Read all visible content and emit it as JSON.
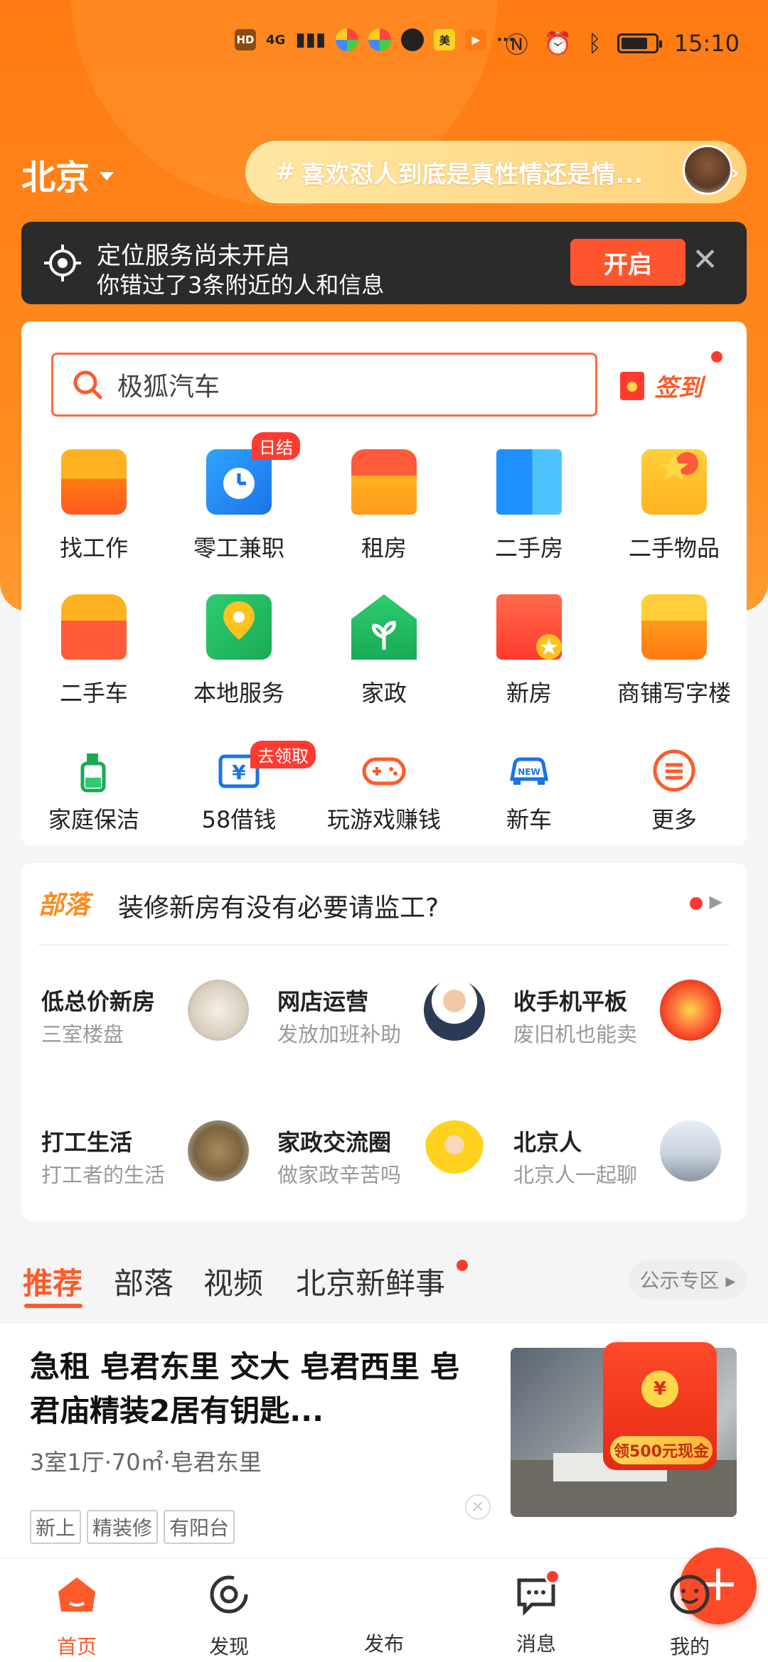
{
  "status_bar": {
    "left_badges": [
      "HD",
      "4G"
    ],
    "meituan_label": "美",
    "more": "···",
    "time": "15:10"
  },
  "header": {
    "city": "北京",
    "topic_hash": "#",
    "topic_text": "喜欢怼人到底是真性情还是情...",
    "chevron": "›"
  },
  "location_banner": {
    "title": "定位服务尚未开启",
    "subtitle": "你错过了3条附近的人和信息",
    "button": "开启",
    "close": "✕"
  },
  "search": {
    "placeholder": "极狐汽车",
    "signin_label": "签到"
  },
  "categories": [
    {
      "label": "找工作",
      "icon": "briefcase-icon"
    },
    {
      "label": "零工兼职",
      "icon": "clock-icon",
      "badge": "日结"
    },
    {
      "label": "租房",
      "icon": "sofa-icon"
    },
    {
      "label": "二手房",
      "icon": "building-icon"
    },
    {
      "label": "二手物品",
      "icon": "box-icon"
    },
    {
      "label": "二手车",
      "icon": "car-icon"
    },
    {
      "label": "本地服务",
      "icon": "map-pin-icon"
    },
    {
      "label": "家政",
      "icon": "house-leaf-icon"
    },
    {
      "label": "新房",
      "icon": "new-house-icon"
    },
    {
      "label": "商铺写字楼",
      "icon": "shop-icon"
    },
    {
      "label": "家庭保洁",
      "icon": "spray-bottle-icon"
    },
    {
      "label": "58借钱",
      "icon": "yuan-card-icon",
      "badge": "去领取"
    },
    {
      "label": "玩游戏赚钱",
      "icon": "gamepad-icon"
    },
    {
      "label": "新车",
      "icon": "new-car-icon"
    },
    {
      "label": "更多",
      "icon": "more-menu-icon"
    }
  ],
  "tribe": {
    "logo": "部落",
    "question": "装修新房有没有必要请监工?",
    "items": [
      {
        "title": "低总价新房",
        "subtitle": "三室楼盘"
      },
      {
        "title": "网店运营",
        "subtitle": "发放加班补助"
      },
      {
        "title": "收手机平板",
        "subtitle": "废旧机也能卖"
      },
      {
        "title": "打工生活",
        "subtitle": "打工者的生活"
      },
      {
        "title": "家政交流圈",
        "subtitle": "做家政辛苦吗"
      },
      {
        "title": "北京人",
        "subtitle": "北京人一起聊"
      }
    ]
  },
  "feed_tabs": {
    "tabs": [
      "推荐",
      "部落",
      "视频",
      "北京新鲜事"
    ],
    "public_zone": "公示专区 ▸"
  },
  "listing": {
    "title": "急租 皂君东里 交大 皂君西里 皂君庙精装2居有钥匙...",
    "meta": "3室1厅·70㎡·皂君东里",
    "tags": [
      "新上",
      "精装修",
      "有阳台"
    ],
    "promo_coin": "¥",
    "promo_cash": "领500元现金"
  },
  "bottom_nav": {
    "items": [
      "首页",
      "发现",
      "发布",
      "消息",
      "我的"
    ],
    "publish_symbol": "+"
  },
  "colors": {
    "brand_orange": "#ff7a12",
    "accent_red": "#ff5a2a"
  }
}
